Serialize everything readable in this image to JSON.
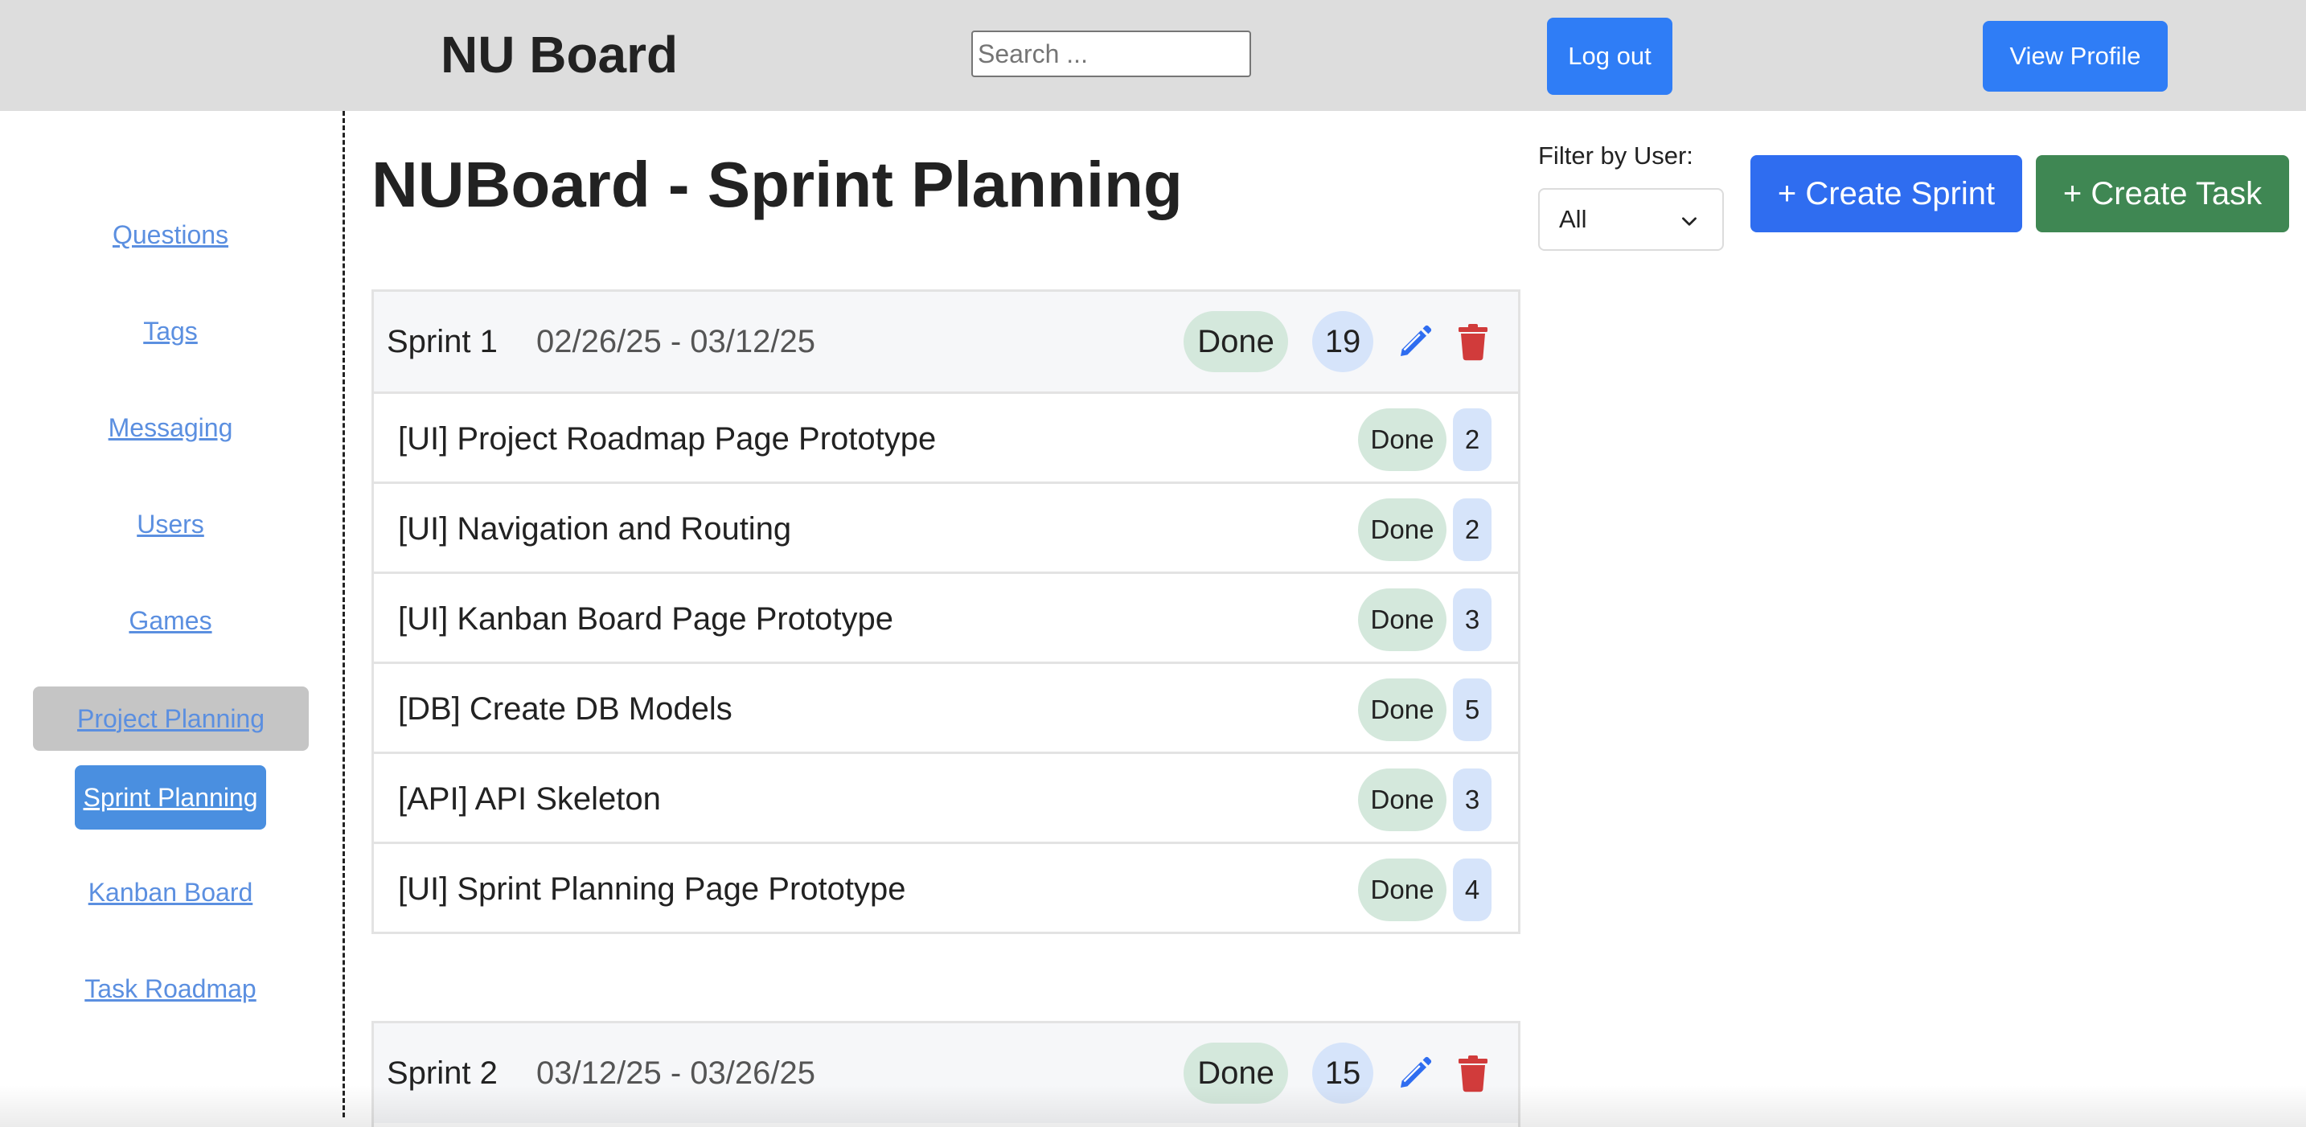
{
  "header": {
    "app_title": "NU Board",
    "search_placeholder": "Search ...",
    "logout_label": "Log out",
    "profile_label": "View Profile"
  },
  "sidebar": {
    "items": [
      {
        "label": "Questions"
      },
      {
        "label": "Tags"
      },
      {
        "label": "Messaging"
      },
      {
        "label": "Users"
      },
      {
        "label": "Games"
      },
      {
        "label": "Project Planning"
      },
      {
        "label": "Sprint Planning",
        "active": true
      },
      {
        "label": "Kanban Board"
      },
      {
        "label": "Task Roadmap"
      }
    ]
  },
  "main": {
    "title": "NUBoard - Sprint Planning",
    "filter_label": "Filter by User:",
    "filter_value": "All",
    "create_sprint_label": "+ Create Sprint",
    "create_task_label": "+ Create Task"
  },
  "sprints": [
    {
      "name": "Sprint 1",
      "dates": "02/26/25 - 03/12/25",
      "status": "Done",
      "points": "19",
      "tasks": [
        {
          "title": "[UI] Project Roadmap Page Prototype",
          "status": "Done",
          "points": "2"
        },
        {
          "title": "[UI] Navigation and Routing",
          "status": "Done",
          "points": "2"
        },
        {
          "title": "[UI] Kanban Board Page Prototype",
          "status": "Done",
          "points": "3"
        },
        {
          "title": "[DB] Create DB Models",
          "status": "Done",
          "points": "5"
        },
        {
          "title": "[API] API Skeleton",
          "status": "Done",
          "points": "3"
        },
        {
          "title": "[UI] Sprint Planning Page Prototype",
          "status": "Done",
          "points": "4"
        }
      ]
    },
    {
      "name": "Sprint 2",
      "dates": "03/12/25 - 03/26/25",
      "status": "Done",
      "points": "15",
      "tasks": []
    }
  ],
  "colors": {
    "primary": "#2f6df0",
    "success": "#3f8753",
    "danger": "#d13b3b",
    "status_pill": "#d4e8dc",
    "points_pill": "#d6e4fa"
  }
}
